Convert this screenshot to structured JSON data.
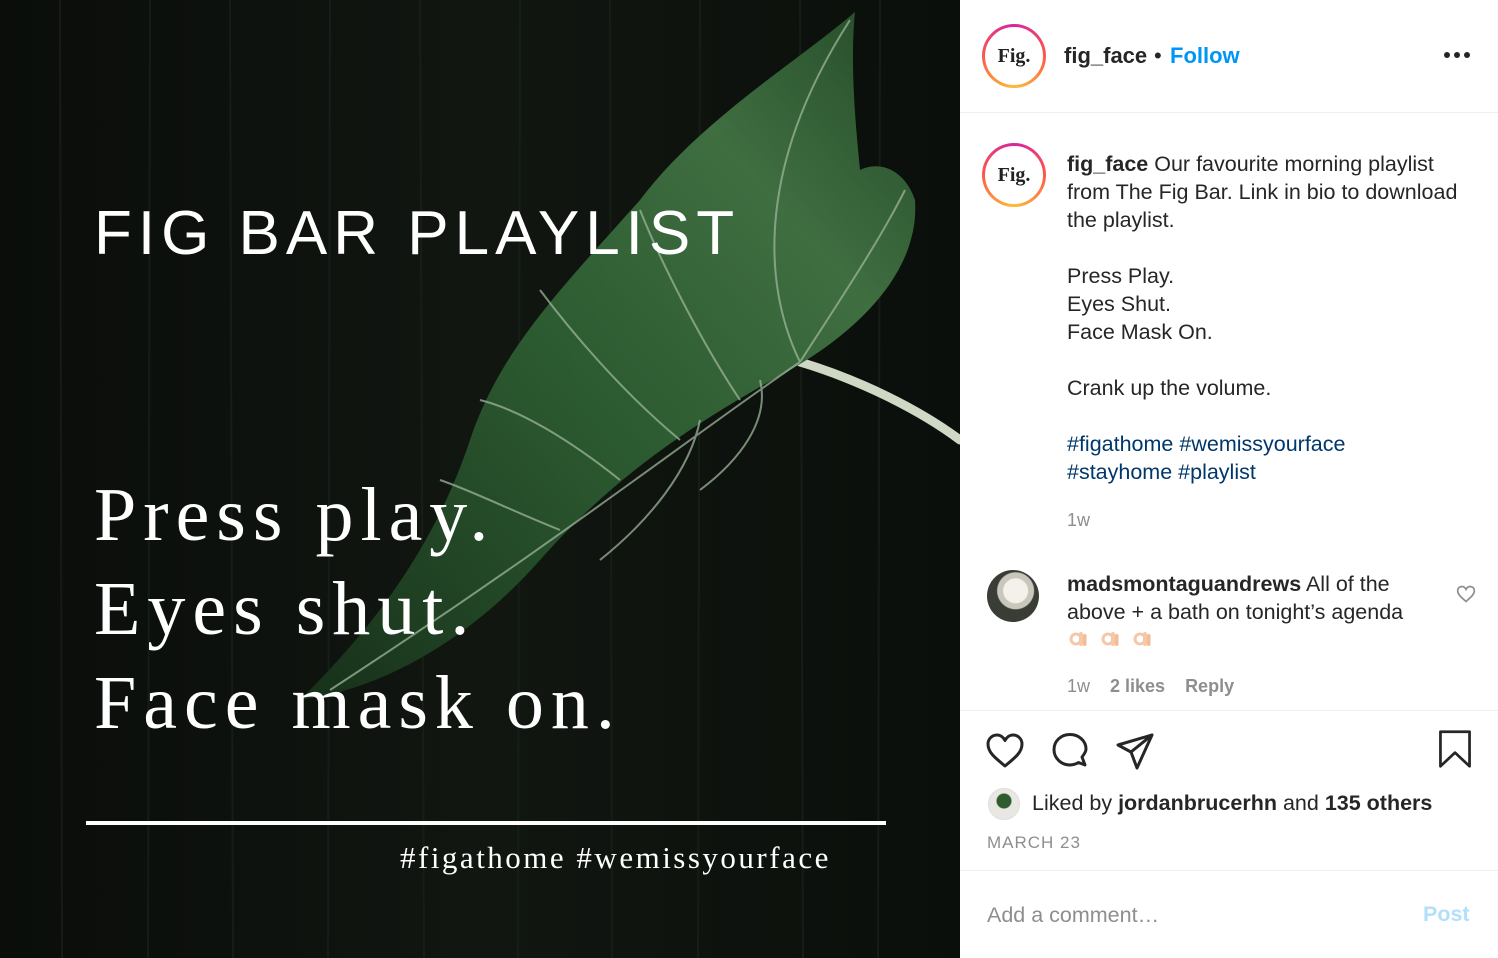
{
  "post": {
    "title": "FIG BAR PLAYLIST",
    "lines": [
      "Press play.",
      "Eyes shut.",
      "Face mask on."
    ],
    "tags": "#figathome #wemissyourface"
  },
  "header": {
    "avatar_text": "Fig.",
    "username": "fig_face",
    "separator": "•",
    "follow_label": "Follow",
    "more_icon": "more-options-icon"
  },
  "caption": {
    "avatar_text": "Fig.",
    "username": "fig_face",
    "line1": "Our favourite morning playlist from The Fig Bar. Link in bio to download the playlist.",
    "line2": "Press Play.",
    "line3": "Eyes Shut.",
    "line4": "Face Mask On.",
    "line5": "Crank up the volume.",
    "hashtags": [
      "#figathome",
      "#wemissyourface",
      "#stayhome",
      "#playlist"
    ],
    "time": "1w"
  },
  "comment": {
    "username": "madsmontaguandrews",
    "text": "All of the above + a bath on tonight’s agenda",
    "emoji": [
      "ok-hand-emoji",
      "ok-hand-emoji",
      "ok-hand-emoji"
    ],
    "time": "1w",
    "likes": "2 likes",
    "reply_label": "Reply"
  },
  "actions": {
    "icons": [
      "heart-icon",
      "comment-icon",
      "share-icon",
      "bookmark-icon"
    ],
    "liked_prefix": "Liked by",
    "liked_user": "jordanbrucerhn",
    "liked_mid": "and",
    "liked_others": "135 others",
    "date": "MARCH 23"
  },
  "add_comment": {
    "placeholder": "Add a comment…",
    "post_label": "Post"
  },
  "colors": {
    "accent": "#0095f6",
    "hashtag": "#00376b",
    "muted": "#8e8e8e",
    "post_disabled": "#b2dffc"
  }
}
